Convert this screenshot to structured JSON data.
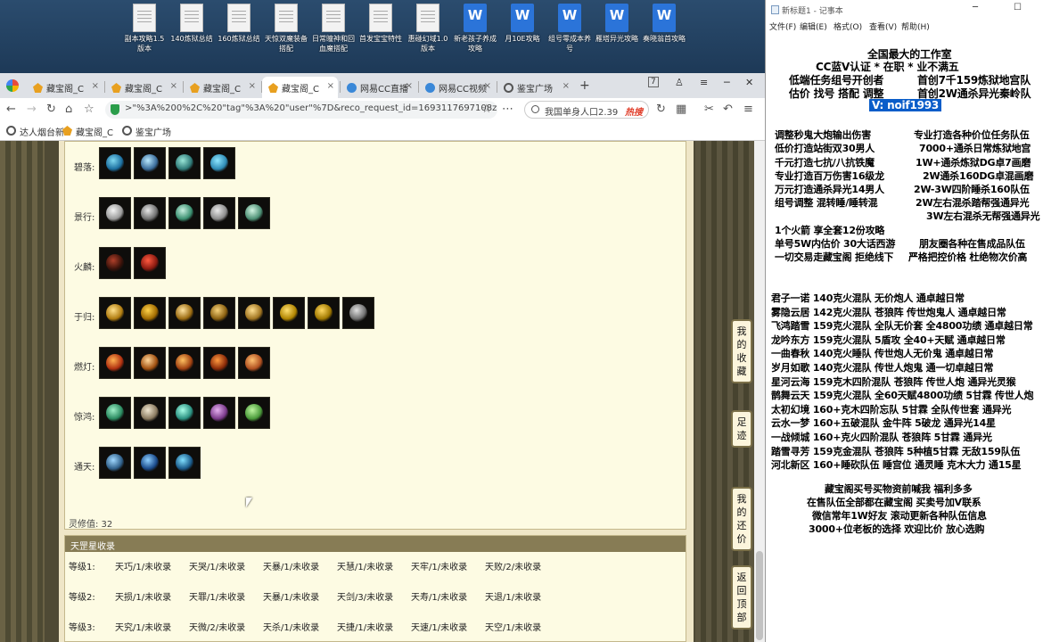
{
  "desktop": {
    "icons": [
      {
        "label": "副本攻略1.5版本",
        "kind": "txt"
      },
      {
        "label": "140炼狱总结",
        "kind": "txt"
      },
      {
        "label": "160炼狱总结",
        "kind": "txt"
      },
      {
        "label": "天惊双魔装备搭配",
        "kind": "txt"
      },
      {
        "label": "日常瞳神和回血魔搭配",
        "kind": "txt"
      },
      {
        "label": "首发宝宝特性",
        "kind": "txt"
      },
      {
        "label": "惠碰幻域1.0版本",
        "kind": "txt"
      },
      {
        "label": "新老孩子养成攻略",
        "kind": "doc"
      },
      {
        "label": "月10E攻略",
        "kind": "doc"
      },
      {
        "label": "组号零成本养号",
        "kind": "doc"
      },
      {
        "label": "雁塔异光攻略",
        "kind": "doc"
      },
      {
        "label": "奏晓翁首攻略",
        "kind": "doc"
      }
    ]
  },
  "browser": {
    "tabs": [
      {
        "label": "藏宝阁_C",
        "fav": "gold",
        "active": false
      },
      {
        "label": "藏宝阁_C",
        "fav": "gold",
        "active": false
      },
      {
        "label": "藏宝阁_C",
        "fav": "gold",
        "active": false
      },
      {
        "label": "藏宝阁_C",
        "fav": "gold",
        "active": true
      },
      {
        "label": "网易CC直播",
        "fav": "cc",
        "active": false
      },
      {
        "label": "网易CC视频",
        "fav": "cc",
        "active": false
      },
      {
        "label": "鉴宝广场",
        "fav": "globe",
        "active": false
      }
    ],
    "window_badge": "7",
    "address": ">\"%3A%200%2C%20\"tag\"%3A%20\"user\"%7D&reco_request_id=1693117697108zdjb_",
    "search_text": "我国单身人口2.39",
    "search_hot": "热搜",
    "bookmarks": [
      "达人烟台新",
      "藏宝阁_C",
      "鉴宝广场"
    ]
  },
  "page": {
    "groups": [
      {
        "label": "碧落:",
        "items": [
          "蓝色护腕",
          "蓝色护手",
          "青玉项圈",
          "水蓝披风"
        ],
        "colors": [
          [
            "#7fd8f0",
            "#1c6fa0"
          ],
          [
            "#b9e9ff",
            "#3a6c9a"
          ],
          [
            "#99e6d8",
            "#2f7a78"
          ],
          [
            "#8ee7ff",
            "#2e8bb5"
          ]
        ]
      },
      {
        "label": "景行:",
        "items": [
          "白色长袍",
          "银色护甲",
          "翠玉腰环",
          "银白战甲",
          "碧玉手镯"
        ],
        "colors": [
          [
            "#f4f4f4",
            "#9a9a9a"
          ],
          [
            "#e8e8e8",
            "#707070"
          ],
          [
            "#c8f0e0",
            "#3a8f70"
          ],
          [
            "#eaeaea",
            "#8c8c8c"
          ],
          [
            "#d2f5e2",
            "#4c8f74"
          ]
        ]
      },
      {
        "label": "火麟:",
        "items": [
          "暗红面具",
          "火焰战刃"
        ],
        "colors": [
          [
            "#b0402a",
            "#3a120a"
          ],
          [
            "#ff5a40",
            "#8a1a10"
          ]
        ]
      },
      {
        "label": "于归:",
        "items": [
          "金色法袍",
          "金色花冠",
          "金色项链",
          "金丝披风",
          "金色面具",
          "金色戒指",
          "金色指环",
          "银色护腕"
        ],
        "colors": [
          [
            "#ffe08a",
            "#b07c10"
          ],
          [
            "#ffd24a",
            "#a06a00"
          ],
          [
            "#ffe3a0",
            "#9a6a10"
          ],
          [
            "#f7d27a",
            "#8a6010"
          ],
          [
            "#ffdf90",
            "#a07420"
          ],
          [
            "#ffe070",
            "#b08400"
          ],
          [
            "#ffd860",
            "#a07800"
          ],
          [
            "#e0e0e0",
            "#707070"
          ]
        ]
      },
      {
        "label": "燃灯:",
        "items": [
          "赤焰头冠",
          "金色灯袍",
          "红金兽首",
          "赤金护心",
          "火纹披风"
        ],
        "colors": [
          [
            "#ffb050",
            "#b03010"
          ],
          [
            "#ffd79a",
            "#a05010"
          ],
          [
            "#ffc060",
            "#a04010"
          ],
          [
            "#ff9a40",
            "#8a2a08"
          ],
          [
            "#ffc070",
            "#b05020"
          ]
        ]
      },
      {
        "label": "惊鸿:",
        "items": [
          "碧绿长衫",
          "白骨头盔",
          "翠玉项链",
          "紫色长鞭",
          "翡翠羽扇"
        ],
        "colors": [
          [
            "#9ff0c8",
            "#2a8a60"
          ],
          [
            "#f0e6d0",
            "#8a7a60"
          ],
          [
            "#a8ffe8",
            "#2a9080"
          ],
          [
            "#e5b0f0",
            "#7a3a8a"
          ],
          [
            "#bdf5a0",
            "#4a9a3a"
          ]
        ]
      },
      {
        "label": "通天:",
        "items": [
          "青钢弯刀",
          "星蓝宝珠",
          "碧蓝法杖"
        ],
        "colors": [
          [
            "#a0d8ff",
            "#30608a"
          ],
          [
            "#8fd0ff",
            "#1a4a8a"
          ],
          [
            "#80e0ff",
            "#1a5a8a"
          ]
        ]
      }
    ],
    "lingxiu": "灵修值: 32",
    "collection_title": "天罡星收录",
    "levels": [
      {
        "label": "等级1:",
        "items": [
          "天巧/1/未收录",
          "天哭/1/未收录",
          "天暴/1/未收录",
          "天慧/1/未收录",
          "天牢/1/未收录",
          "天败/2/未收录"
        ]
      },
      {
        "label": "等级2:",
        "items": [
          "天损/1/未收录",
          "天罪/1/未收录",
          "天暴/1/未收录",
          "天剑/3/未收录",
          "天寿/1/未收录",
          "天退/1/未收录"
        ]
      },
      {
        "label": "等级3:",
        "items": [
          "天究/1/未收录",
          "天微/2/未收录",
          "天杀/1/未收录",
          "天捷/1/未收录",
          "天速/1/未收录",
          "天空/1/未收录"
        ]
      }
    ],
    "side_buttons": [
      {
        "name": "my-favorites",
        "chars": [
          "我",
          "的",
          "收",
          "藏"
        ]
      },
      {
        "name": "footprints",
        "chars": [
          "足",
          "迹"
        ]
      },
      {
        "name": "my-bargains",
        "chars": [
          "我",
          "的",
          "还",
          "价"
        ]
      },
      {
        "name": "back-to-top",
        "chars": [
          "返",
          "回",
          "顶",
          "部"
        ]
      }
    ]
  },
  "notepad": {
    "title": "新标题1 - 记事本",
    "menu": [
      "文件(F)",
      "编辑(E)",
      "格式(O)",
      "查看(V)",
      "帮助(H)"
    ],
    "lines_top": [
      {
        "text": "全国最大的工作室",
        "size": "big"
      },
      {
        "text": "CC蓝V认证 * 在职 * 业不满五",
        "size": "big"
      },
      {
        "text": "低端任务组号开创者",
        "size": "big"
      },
      {
        "text": "首创7千159炼狱地宫队",
        "size": "big"
      },
      {
        "text": "估价 找号 搭配 调整",
        "size": "big"
      },
      {
        "text": "首创2W通杀异光秦岭队",
        "size": "big"
      },
      {
        "text": "V: noif1993",
        "size": "big"
      }
    ],
    "lines_mid": [
      "调整秒鬼大炮输出伤害",
      "专业打造各种价位任务队伍",
      "低价打造站街双30男人",
      "7000+通杀日常炼狱地宫",
      "千元打造七抗/八抗铁魔",
      "1W+通杀炼狱DG卓7画磨",
      "专业打造百万伤害16级龙",
      "2W通杀160DG卓混画磨",
      "万元打造通杀异光14男人",
      "2W-3W四阶睡杀160队伍",
      "组号调整 混转睡/睡转混",
      "2W左右混杀踏帮强通异光",
      "3W左右混杀无帮强通异光",
      "1个火箭 享全套12份攻略",
      "单号5W内估价 30大话西游",
      "朋友圈各种在售成品队伍",
      "一切交易走藏宝阁 拒绝线下",
      "严格把控价格 杜绝物次价高"
    ],
    "lines_list": [
      "君子一诺 140克火混队 无价炮人 通卓越日常",
      "雾隐云居 142克火混队 苍狼阵 传世炮鬼人 通卓越日常",
      "飞鸿踏雪 159克火混队 全队无价套 全4800功绩 通卓越日常",
      "龙吟东方 159克火混队 5盾攻 全40+天赋 通卓越日常",
      "一曲春秋 140克火睡队 传世炮人无价鬼 通卓越日常",
      "岁月如歌 140克火混队 传世人炮鬼 通一切卓越日常",
      "星河云海 159克木四阶混队 苍狼阵 传世人炮 通异光灵猴",
      "鹊舞云天 159克火混队 全60天赋4800功绩 5甘霖 传世人炮",
      "太初幻境 160+克木四阶忘队 5甘霖 全队传世套 通异光",
      "云水一梦 160+五破混队 金牛阵 5破龙 通异光14星",
      "一战倾城 160+克火四阶混队 苍狼阵 5甘霖 通异光",
      "踏雪寻芳 159克金混队 苍狼阵 5种植5甘霖 无敌159队伍",
      "河北新区 160+睡砍队伍 睡宫位 通灵睡 克木大力 通15星"
    ],
    "lines_bottom": [
      "藏宝阁买号买物资前喊我 福利多多",
      "在售队伍全部都在藏宝阁 买卖号加V联系",
      "微信常年1W好友 滚动更新各种队伍信息",
      "3000+位老板的选择 欢迎比价 放心选购"
    ]
  }
}
